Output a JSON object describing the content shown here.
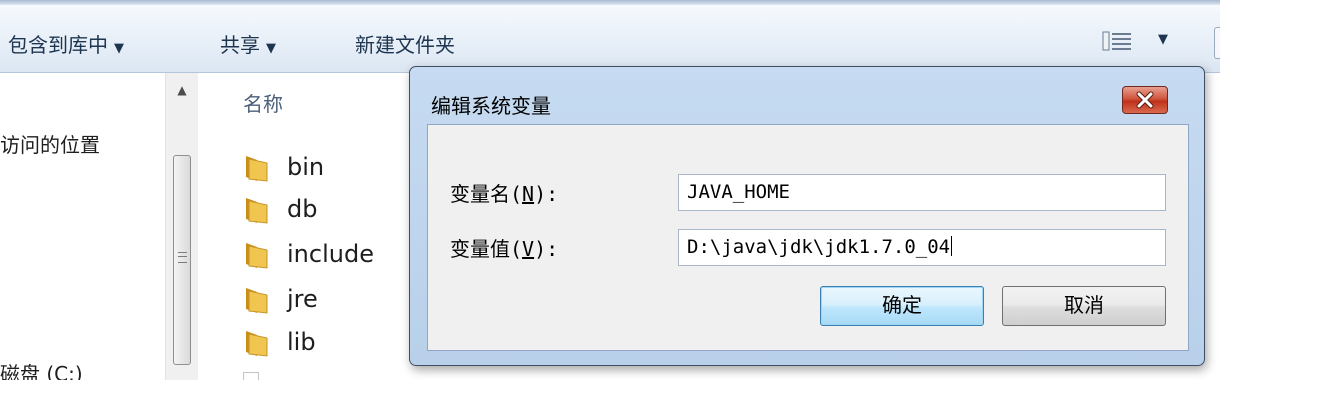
{
  "toolbar": {
    "include_in_library": "包含到库中",
    "share": "共享",
    "new_folder": "新建文件夹"
  },
  "nav": {
    "recent_places_partial": "访问的位置",
    "local_disk_partial": "磁盘 (C:)"
  },
  "file_list": {
    "column_name": "名称",
    "items": [
      "bin",
      "db",
      "include",
      "jre",
      "lib"
    ]
  },
  "dialog": {
    "title": "编辑系统变量",
    "name_label": "变量名(N):",
    "name_mnemonic": "N",
    "value_label": "变量值(V):",
    "value_mnemonic": "V",
    "name_value": "JAVA_HOME",
    "value_value": "D:\\java\\jdk\\jdk1.7.0_04",
    "ok_label": "确定",
    "cancel_label": "取消"
  },
  "colors": {
    "folder": "#e8b83a",
    "close_button": "#c7402a",
    "default_button_border": "#3c7fb1"
  }
}
